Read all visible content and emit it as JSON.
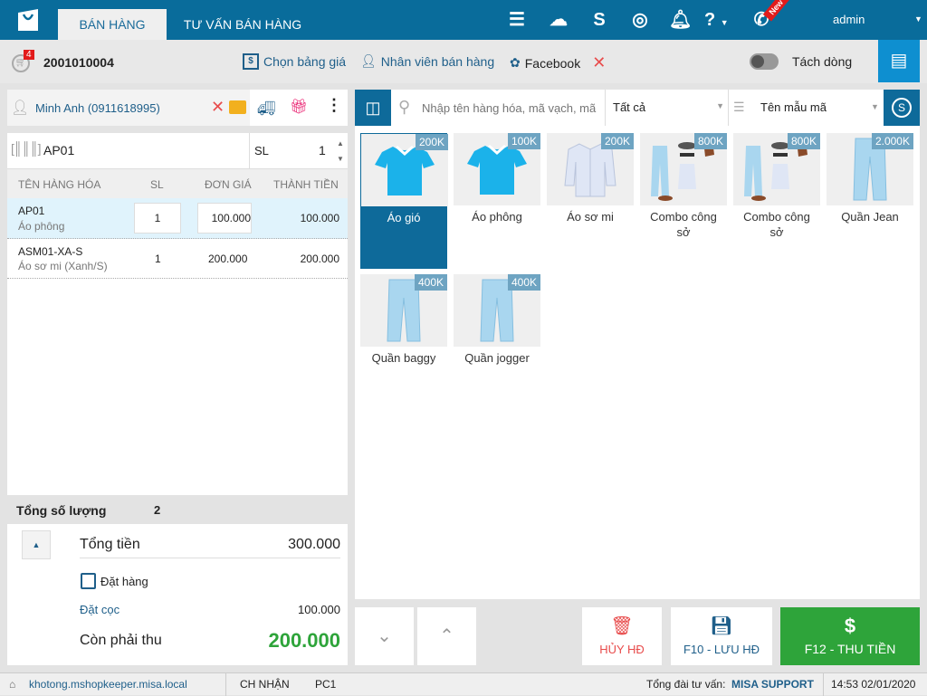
{
  "header": {
    "tabs": [
      {
        "label": "BÁN HÀNG",
        "active": true
      },
      {
        "label": "TƯ VẤN BÁN HÀNG",
        "active": false
      }
    ],
    "new_badge": "New",
    "user": "admin",
    "icons": [
      "menu-icon",
      "cloud-sync-icon",
      "s-coin-icon",
      "swirl-icon",
      "bell-icon",
      "help-icon",
      "phone-icon"
    ]
  },
  "toolbar": {
    "cart_count": "4",
    "invoice_no": "2001010004",
    "price_list": "Chọn bảng giá",
    "staff": "Nhân viên bán hàng",
    "facebook": "Facebook",
    "split_line": "Tách dòng",
    "split_on": false
  },
  "customer": {
    "name": "Minh Anh (0911618995)"
  },
  "scan": {
    "code": "AP01",
    "qty_label": "SL",
    "qty": "1"
  },
  "cart": {
    "columns": [
      "TÊN HÀNG HÓA",
      "SL",
      "ĐƠN GIÁ",
      "THÀNH TIỀN"
    ],
    "rows": [
      {
        "code": "AP01",
        "name": "Áo phông",
        "qty": "1",
        "price": "100.000",
        "total": "100.000"
      },
      {
        "code": "ASM01-XA-S",
        "name": "Áo sơ mi (Xanh/S)",
        "qty": "1",
        "price": "200.000",
        "total": "200.000"
      }
    ]
  },
  "summary": {
    "qty_label": "Tổng số lượng",
    "qty": "2",
    "total_label": "Tổng tiền",
    "total": "300.000",
    "order_label": "Đặt hàng",
    "order_checked": false,
    "deposit_label": "Đặt cọc",
    "deposit": "100.000",
    "due_label": "Còn phải thu",
    "due": "200.000"
  },
  "search": {
    "placeholder": "Nhập tên hàng hóa, mã vạch, mã",
    "category": "Tất cả",
    "sort": "Tên mẫu mã"
  },
  "products": [
    {
      "name": "Áo gió",
      "price": "200K",
      "type": "tshirt",
      "selected": true
    },
    {
      "name": "Áo phông",
      "price": "100K",
      "type": "tshirt"
    },
    {
      "name": "Áo sơ mi",
      "price": "200K",
      "type": "shirt"
    },
    {
      "name": "Combo công sở",
      "price": "800K",
      "type": "combo"
    },
    {
      "name": "Combo công sở",
      "price": "800K",
      "type": "combo"
    },
    {
      "name": "Quần Jean",
      "price": "2.000K",
      "type": "pants"
    },
    {
      "name": "Quần baggy",
      "price": "400K",
      "type": "pants"
    },
    {
      "name": "Quần jogger",
      "price": "400K",
      "type": "pants"
    }
  ],
  "actions": {
    "cancel": "HỦY HĐ",
    "save": "F10 - LƯU HĐ",
    "pay": "F12 - THU TIỀN"
  },
  "status": {
    "host": "khotong.mshopkeeper.misa.local",
    "branch": "CH NHẬN",
    "pc": "PC1",
    "support_label": "Tổng đài tư vấn:",
    "support": "MISA SUPPORT",
    "datetime": "14:53 02/01/2020"
  },
  "colors": {
    "brand": "#096c9b",
    "pay": "#2ea43a",
    "due": "#2ea43a",
    "cancel": "#e84c4c"
  }
}
